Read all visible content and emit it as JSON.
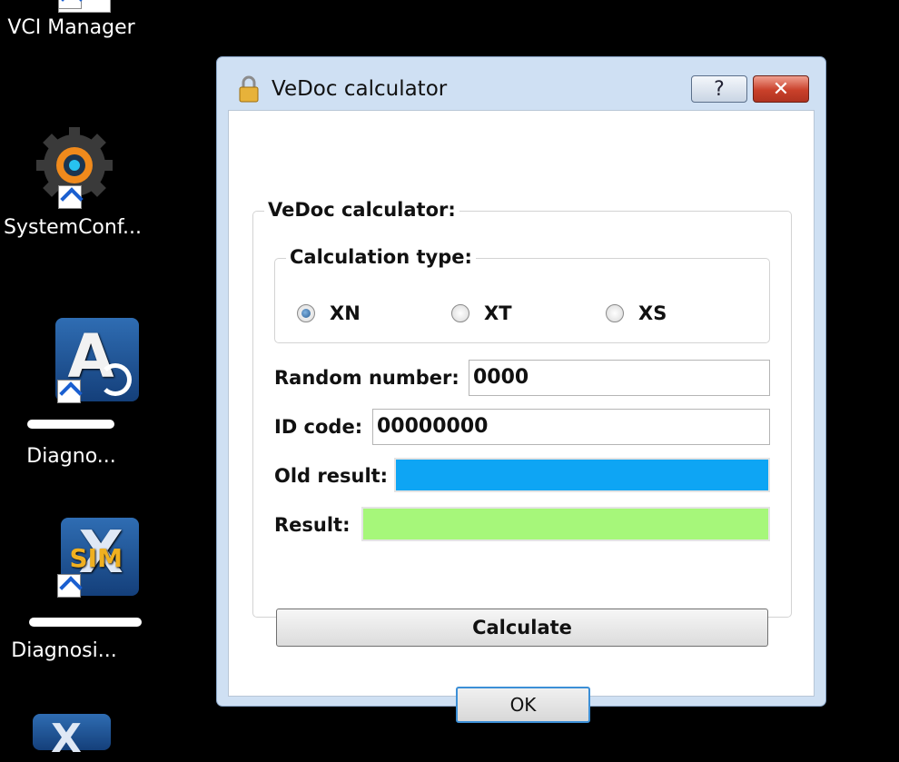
{
  "desktop": {
    "icons": [
      {
        "label": "VCI Manager",
        "icon": "vci-manager-icon"
      },
      {
        "label": "SystemConf...",
        "icon": "system-config-gear-icon"
      },
      {
        "label": "Diagno...",
        "icon": "xentry-a-diagnosis-icon"
      },
      {
        "label": "Diagnosi...",
        "icon": "xentry-sim-diagnosis-icon"
      }
    ]
  },
  "window": {
    "title": "VeDoc calculator",
    "help_label": "?",
    "close_label": "✕",
    "group_title": "VeDoc calculator:",
    "calc_type": {
      "title": "Calculation type:",
      "options": [
        "XN",
        "XT",
        "XS"
      ],
      "selected": "XN"
    },
    "random_number": {
      "label": "Random number:",
      "value": "0000"
    },
    "id_code": {
      "label": "ID code:",
      "value": "00000000"
    },
    "old_result": {
      "label": "Old result:",
      "value": "",
      "color": "#0ea5f4"
    },
    "result": {
      "label": "Result:",
      "value": "",
      "color": "#a6f77a"
    },
    "calculate_label": "Calculate",
    "ok_label": "OK"
  }
}
